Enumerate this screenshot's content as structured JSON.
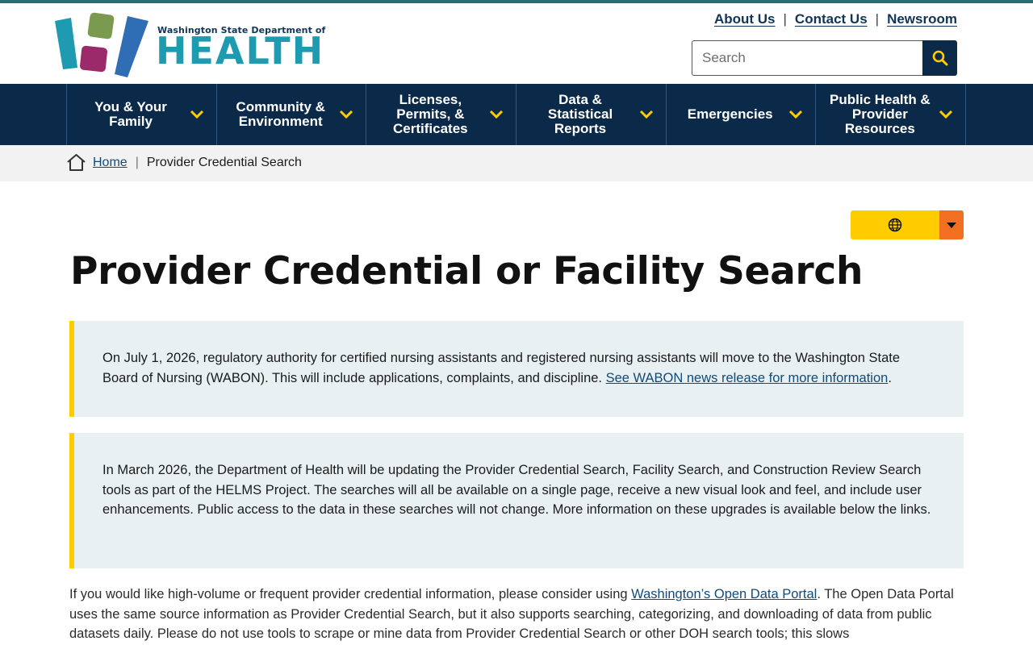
{
  "header": {
    "logo_small": "Washington State Department of",
    "logo_big": "HEALTH",
    "utility_links": [
      "About Us",
      "Contact Us",
      "Newsroom"
    ],
    "search_placeholder": "Search"
  },
  "nav": {
    "items": [
      "You & Your Family",
      "Community & Environment",
      "Licenses, Permits, & Certificates",
      "Data & Statistical Reports",
      "Emergencies",
      "Public Health & Provider Resources"
    ]
  },
  "breadcrumb": {
    "home": "Home",
    "current": "Provider Credential Search"
  },
  "page": {
    "title": "Provider Credential or Facility Search",
    "alert1_text": "On July 1, 2026, regulatory authority for certified nursing assistants and registered nursing assistants will move to the Washington State Board of Nursing (WABON). This will include applications, complaints, and discipline. ",
    "alert1_link": "See WABON news release for more information",
    "alert1_end": ".",
    "alert2_text": "In March 2026, the Department of Health will be updating the Provider Credential Search, Facility Search, and Construction Review Search tools as part of the HELMS Project. The searches will all be available on a single page, receive a new visual look and feel, and include user enhancements. Public access to the data in these searches will not change. More information on these upgrades is available below the links.",
    "para_start": "If you would like high-volume or frequent provider credential information, please consider using ",
    "para_link": "Washington’s Open Data Portal",
    "para_rest": ". The Open Data Portal uses the same source information as Provider Credential Search, but it also supports searching, categorizing, and downloading of data from public datasets daily. Please do not use tools to scrape or mine data from Provider Credential Search or other DOH search tools; this slows"
  },
  "colors": {
    "navy": "#0b2a4a",
    "teal": "#1e9bb0",
    "yellow": "#ffcc00",
    "orange": "#f26f21",
    "alert_bg": "#e8f0f2"
  }
}
